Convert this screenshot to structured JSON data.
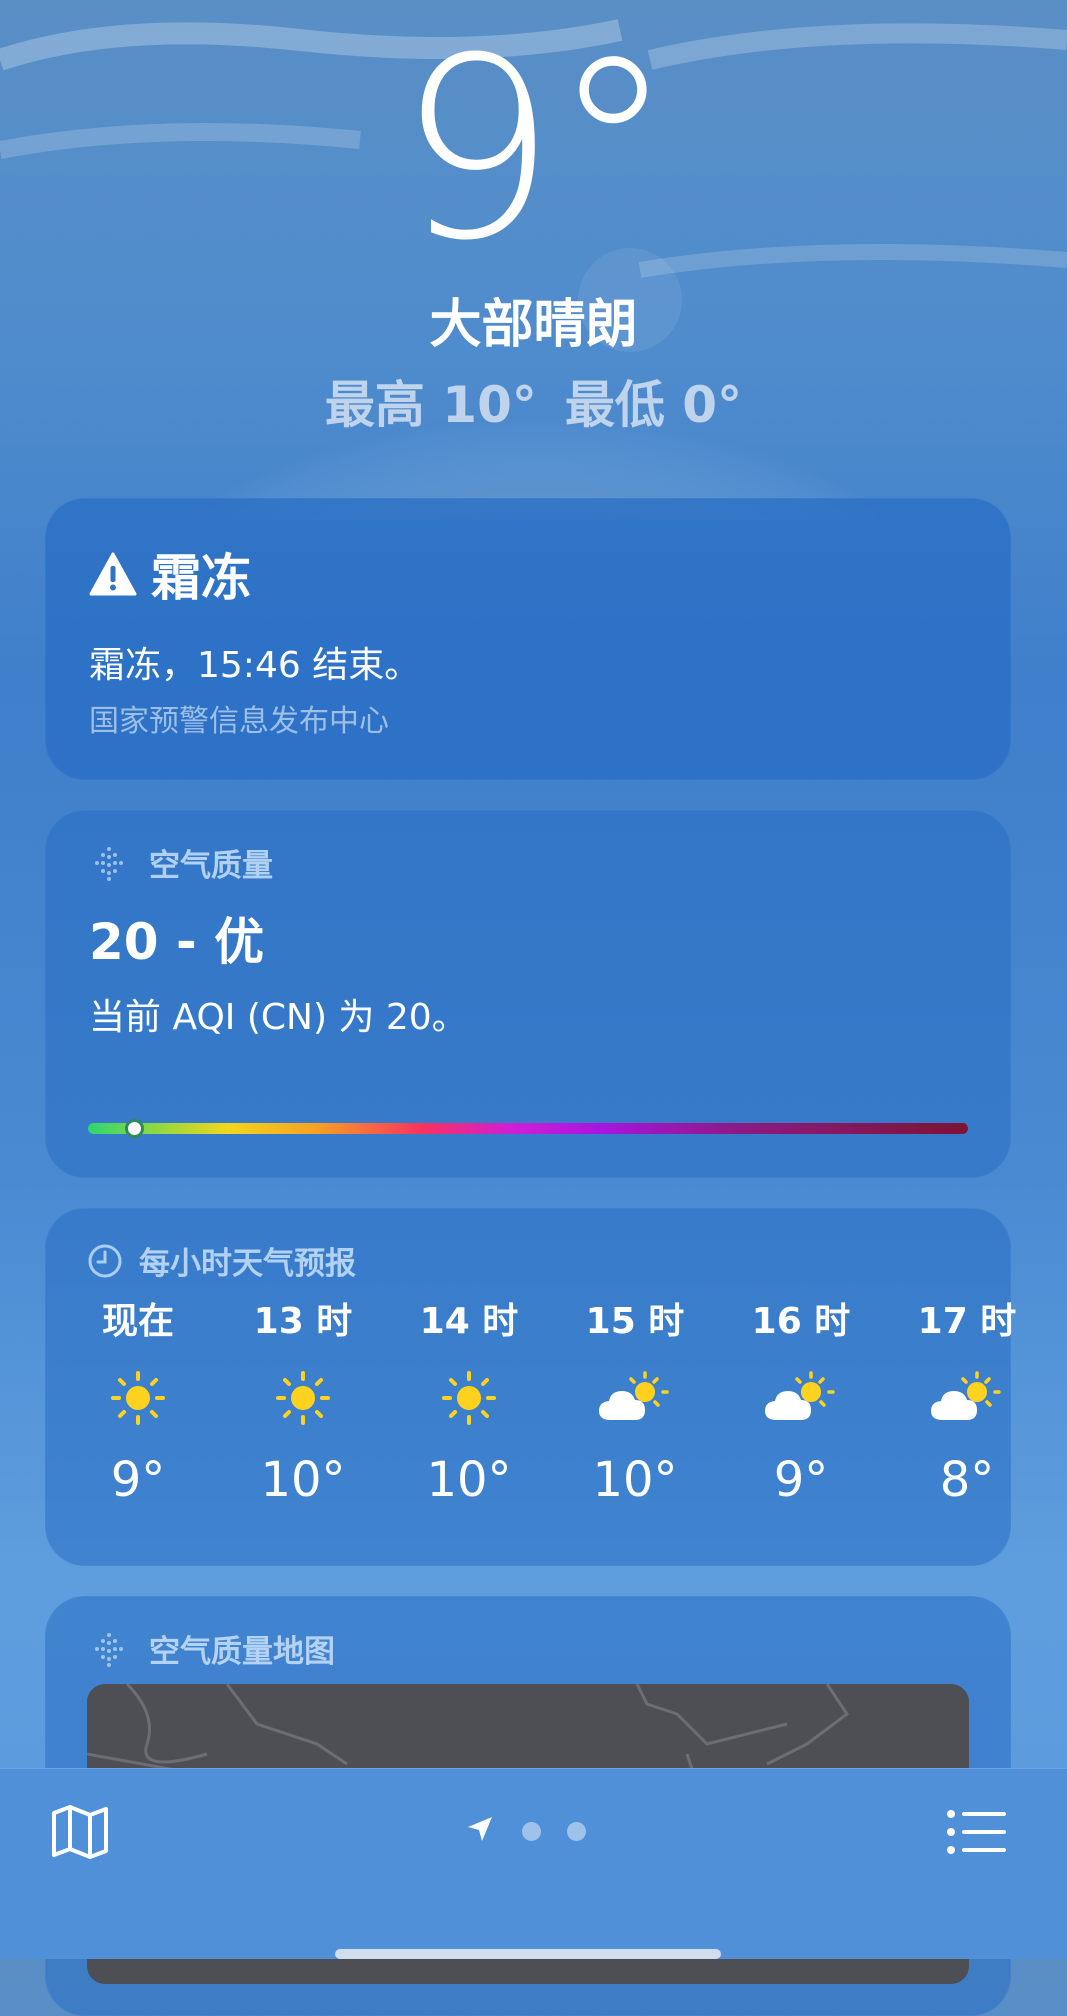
{
  "colors": {
    "background": "#4a89d0",
    "card": "#2e74c4",
    "aqi_good": "#2ed573",
    "sun": "#ffd21f",
    "map": "#4d4f54"
  },
  "current": {
    "temperature": "9°",
    "condition": "大部晴朗",
    "high": "最高 10°",
    "low": "最低 0°"
  },
  "alert": {
    "icon": "warning-triangle-icon",
    "title": "霜冻",
    "message": "霜冻，15:46 结束。",
    "source": "国家预警信息发布中心"
  },
  "air_quality": {
    "icon": "dots-icon",
    "title": "空气质量",
    "value": "20 - 优",
    "description": "当前 AQI (CN) 为 20。",
    "index_fraction": 0.04
  },
  "hourly": {
    "icon": "clock-icon",
    "title": "每小时天气预报",
    "items": [
      {
        "time": "现在",
        "icon": "sun-icon",
        "temp": "9°"
      },
      {
        "time": "13 时",
        "icon": "sun-icon",
        "temp": "10°"
      },
      {
        "time": "14 时",
        "icon": "sun-icon",
        "temp": "10°"
      },
      {
        "time": "15 时",
        "icon": "partly-cloudy-icon",
        "temp": "10°"
      },
      {
        "time": "16 时",
        "icon": "partly-cloudy-icon",
        "temp": "9°"
      },
      {
        "time": "17 时",
        "icon": "partly-cloudy-icon",
        "temp": "8°"
      }
    ]
  },
  "aqi_map": {
    "icon": "dots-icon",
    "title": "空气质量地图"
  },
  "toolbar": {
    "map_icon": "map-icon",
    "location_icon": "location-arrow-icon",
    "page_dots": 2,
    "list_icon": "list-icon"
  }
}
